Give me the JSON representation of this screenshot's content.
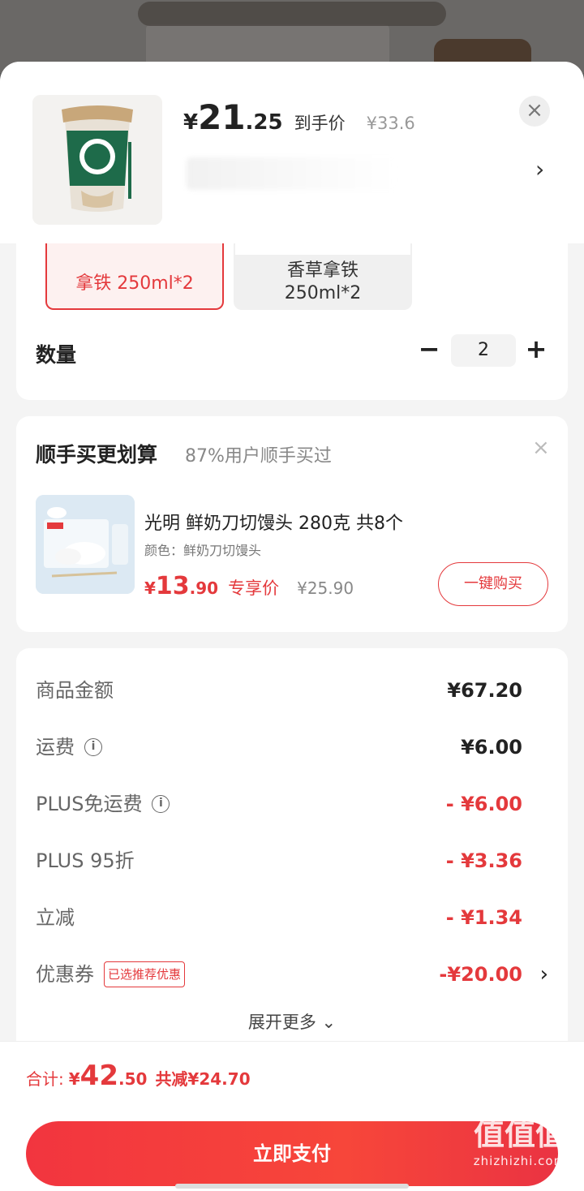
{
  "header": {
    "price_yen": "¥",
    "price_int": "21",
    "price_dec": ".25",
    "price_label": "到手价",
    "orig_price": "¥33.6",
    "close_icon": "×",
    "arrow": "›"
  },
  "spec": {
    "options": [
      {
        "label": "拿铁 250ml*2",
        "selected": true
      },
      {
        "label": "香草拿铁",
        "label2": "250ml*2",
        "selected": false
      }
    ],
    "quantity_label": "数量",
    "quantity": "2",
    "minus": "−",
    "plus": "+"
  },
  "addon": {
    "title": "顺手买更划算",
    "subtitle": "87%用户顺手买过",
    "close_icon": "×",
    "product_name": "光明 鲜奶刀切馒头 280克 共8个",
    "attr": "颜色：鲜奶刀切馒头",
    "price_yen": "¥",
    "price_int": "13",
    "price_dec": ".90",
    "price_tag": "专享价",
    "orig_price": "¥25.90",
    "buy_button": "一键购买"
  },
  "costs": {
    "rows": [
      {
        "label": "商品金额",
        "value": "¥67.20",
        "info": false,
        "red": false
      },
      {
        "label": "运费",
        "value": "¥6.00",
        "info": true,
        "red": false
      },
      {
        "label": "PLUS免运费",
        "value": "- ¥6.00",
        "info": true,
        "red": true
      },
      {
        "label": "PLUS 95折",
        "value": "- ¥3.36",
        "info": false,
        "red": true
      },
      {
        "label": "立减",
        "value": "- ¥1.34",
        "info": false,
        "red": true
      },
      {
        "label": "优惠券",
        "value": "-¥20.00",
        "tag": "已选推荐优惠",
        "red": true
      }
    ],
    "info_icon": "i",
    "expand_label": "展开更多 ⌄"
  },
  "footer": {
    "total_label": "合计:",
    "total_yen": "¥",
    "total_int": "42",
    "total_dec": ".50",
    "total_save": "共减¥24.70",
    "pay_button": "立即支付",
    "watermark": "值值值",
    "watermark_sub": "zhizhizhi.com"
  },
  "colors": {
    "accent": "#e4393c",
    "pay_button": "#f2353f"
  }
}
